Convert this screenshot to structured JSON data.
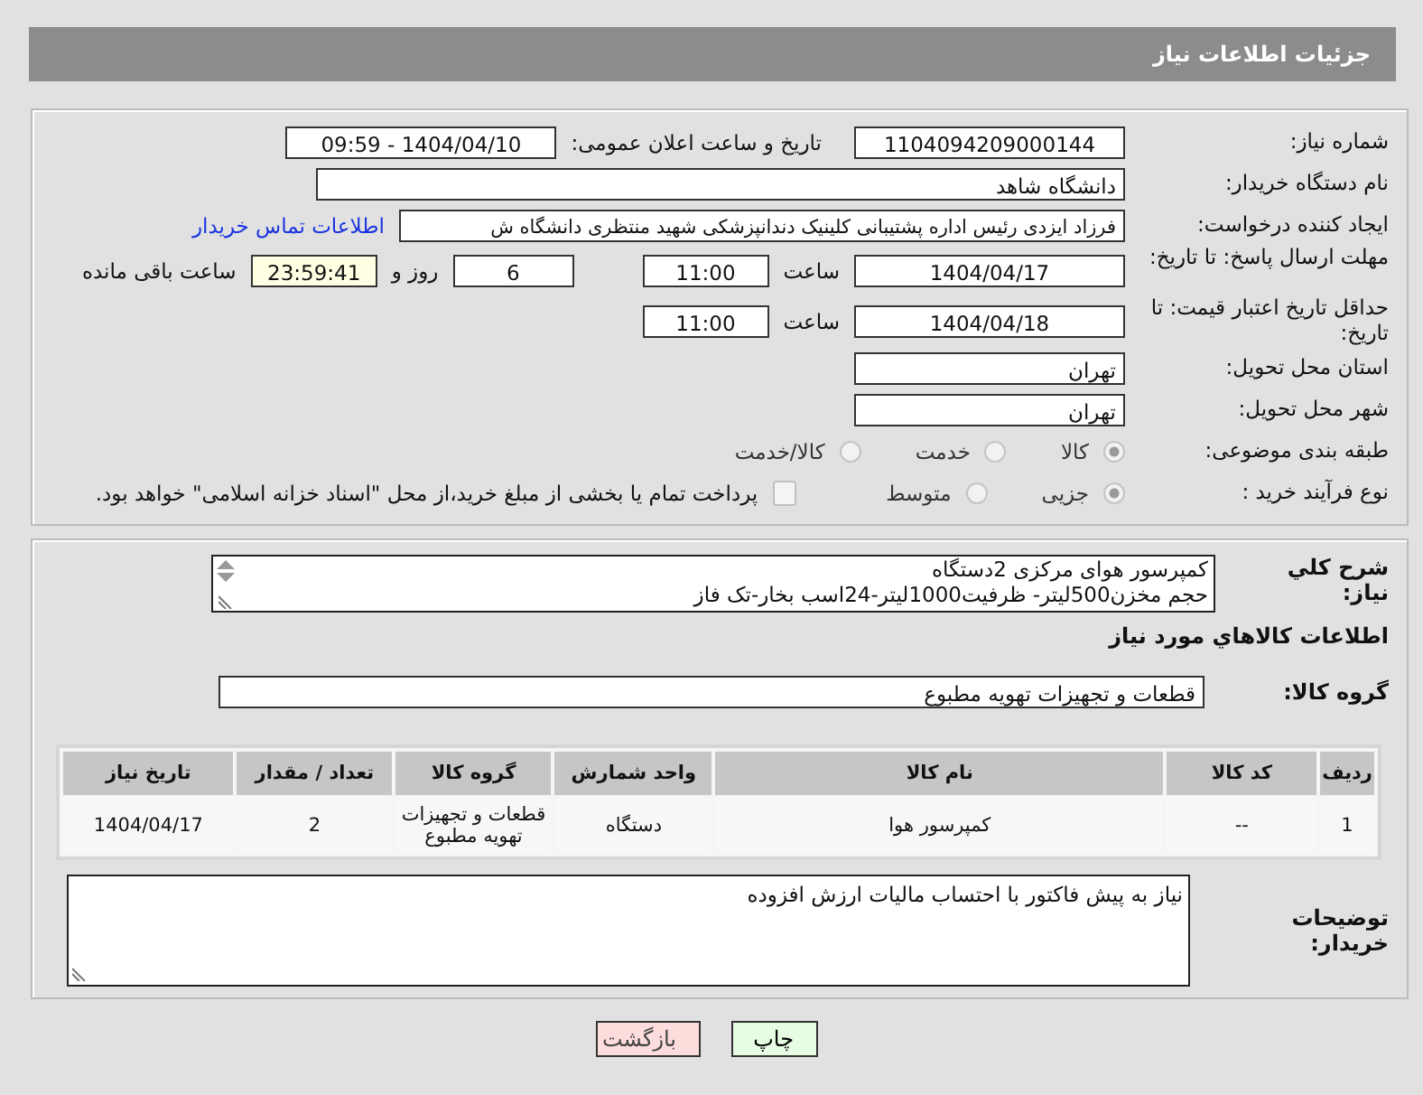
{
  "header": {
    "title": "جزئیات اطلاعات نیاز"
  },
  "details": {
    "need_number": {
      "label": "شماره نیاز:",
      "value": "1104094209000144"
    },
    "announce": {
      "label": "تاریخ و ساعت اعلان عمومی:",
      "value": "1404/04/10 - 09:59"
    },
    "buyer": {
      "label": "نام دستگاه خریدار:",
      "value": "دانشگاه شاهد"
    },
    "creator": {
      "label": "ایجاد کننده درخواست:",
      "value": "فرزاد ایزدی رئیس اداره پشتیبانی کلینیک دندانپزشکی شهید منتظری دانشگاه ش",
      "link": "اطلاعات تماس خریدار"
    },
    "deadline": {
      "label": "مهلت ارسال پاسخ: تا تاریخ:",
      "date": "1404/04/17",
      "time_label": "ساعت",
      "time": "11:00",
      "days": "6",
      "days_label": "روز و",
      "remaining": "23:59:41",
      "remaining_label": "ساعت باقی مانده"
    },
    "validity": {
      "label": "حداقل تاریخ اعتبار قیمت: تا تاریخ:",
      "date": "1404/04/18",
      "time_label": "ساعت",
      "time": "11:00"
    },
    "province": {
      "label": "استان محل تحویل:",
      "value": "تهران"
    },
    "city": {
      "label": "شهر محل تحویل:",
      "value": "تهران"
    },
    "category": {
      "label": "طبقه بندی موضوعی:",
      "options": [
        {
          "label": "کالا",
          "selected": true
        },
        {
          "label": "خدمت",
          "selected": false
        },
        {
          "label": "کالا/خدمت",
          "selected": false
        }
      ]
    },
    "process": {
      "label": "نوع فرآیند خرید :",
      "options": [
        {
          "label": "جزیی",
          "selected": true
        },
        {
          "label": "متوسط",
          "selected": false
        }
      ],
      "treasury": {
        "label": "پرداخت تمام یا بخشی از مبلغ خرید،از محل \"اسناد خزانه اسلامی\" خواهد بود.",
        "checked": false
      }
    }
  },
  "needs": {
    "description": {
      "label": "شرح کلي نياز:",
      "lines": [
        "کمپرسور هوای مرکزی 2دستگاه",
        "حجم مخزن500لیتر- ظرفیت1000لیتر-24اسب بخار-تک فاز"
      ]
    },
    "section_title": "اطلاعات کالاهاي مورد نياز",
    "group": {
      "label": "گروه کالا:",
      "value": "قطعات و تجهیزات تهویه مطبوع"
    },
    "table": {
      "columns": [
        "ردیف",
        "کد کالا",
        "نام کالا",
        "واحد شمارش",
        "گروه کالا",
        "تعداد / مقدار",
        "تاریخ نیاز"
      ],
      "rows": [
        [
          "1",
          "--",
          "کمپرسور هوا",
          "دستگاه",
          "قطعات و تجهیزات تهویه مطبوع",
          "2",
          "1404/04/17"
        ]
      ]
    },
    "buyer_notes": {
      "label": "توضیحات خریدار:",
      "value": "نیاز به پیش فاکتور با احتساب مالیات ارزش افزوده"
    }
  },
  "buttons": [
    {
      "label": "چاپ",
      "kind": "print"
    },
    {
      "label": "بازگشت",
      "kind": "back"
    }
  ]
}
